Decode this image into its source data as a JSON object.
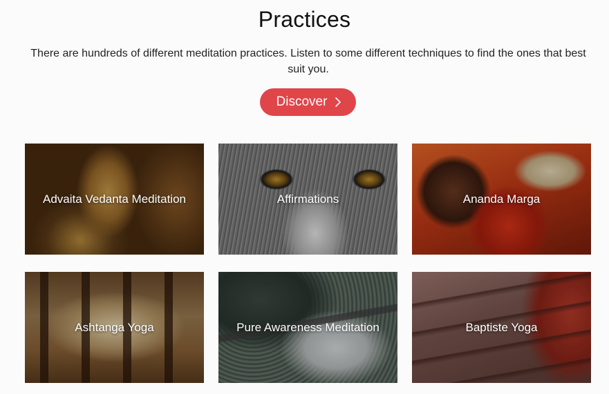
{
  "header": {
    "title": "Practices",
    "description": "There are hundreds of different meditation practices. Listen to some different techniques to find the ones that best suit you."
  },
  "discover_button": {
    "label": "Discover",
    "icon": "chevron-right-icon",
    "color": "#e0454a"
  },
  "practices": [
    {
      "label": "Advaita Vedanta Meditation"
    },
    {
      "label": "Affirmations"
    },
    {
      "label": "Ananda Marga"
    },
    {
      "label": "Ashtanga Yoga"
    },
    {
      "label": "Pure Awareness Meditation"
    },
    {
      "label": "Baptiste Yoga"
    }
  ]
}
